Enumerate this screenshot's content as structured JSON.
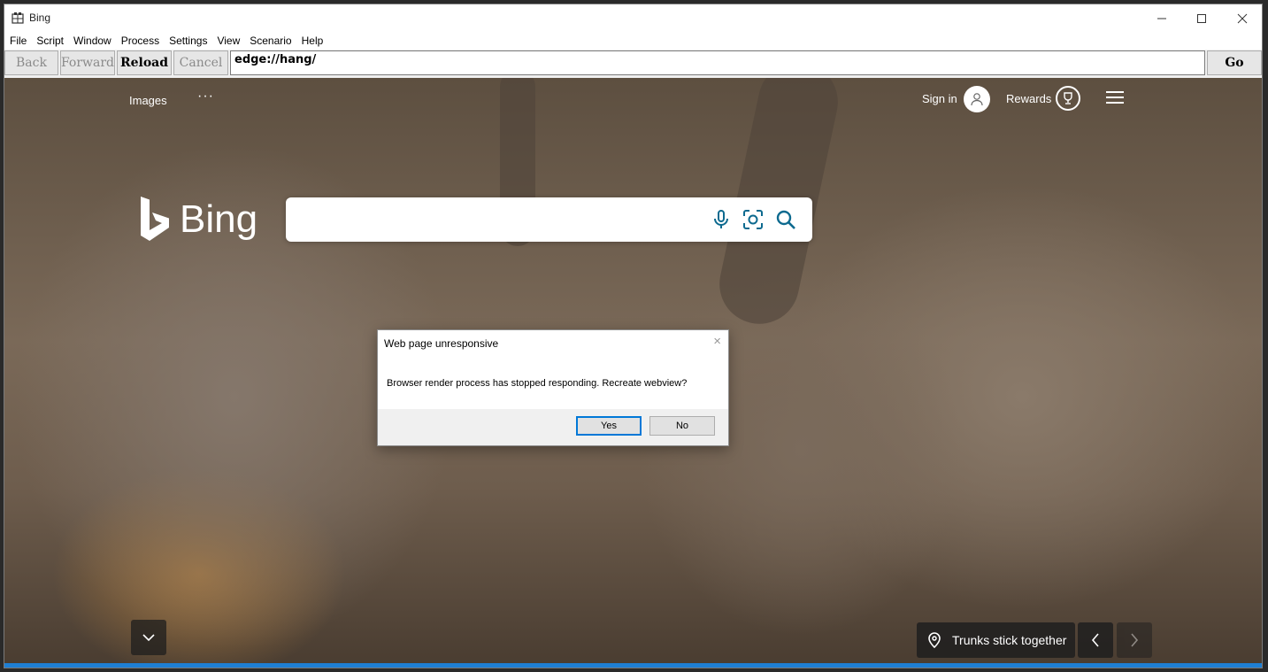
{
  "window": {
    "title": "Bing"
  },
  "menu": [
    "File",
    "Script",
    "Window",
    "Process",
    "Settings",
    "View",
    "Scenario",
    "Help"
  ],
  "toolbar": {
    "back": "Back",
    "forward": "Forward",
    "reload": "Reload",
    "cancel": "Cancel",
    "url": "edge://hang/",
    "go": "Go"
  },
  "page": {
    "images_link": "Images",
    "more": "···",
    "brand": "Bing",
    "sign_in": "Sign in",
    "rewards": "Rewards",
    "caption": "Trunks stick together",
    "accent_color": "#1e7fd4",
    "icon_color": "#0d6a8f"
  },
  "dialog": {
    "title": "Web page unresponsive",
    "message": "Browser render process has stopped responding.  Recreate webview?",
    "yes": "Yes",
    "no": "No",
    "close": "×"
  }
}
